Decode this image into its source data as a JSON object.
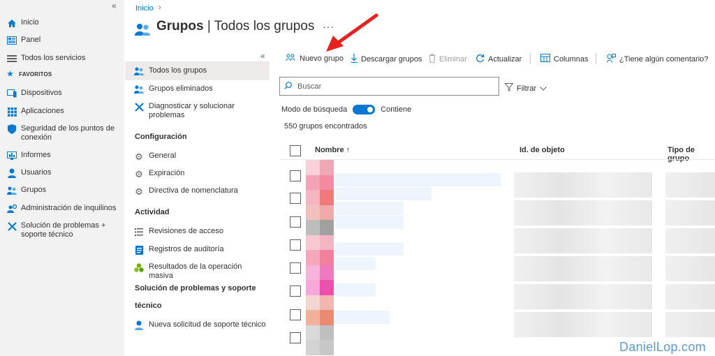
{
  "nav": {
    "items": [
      {
        "label": "Inicio",
        "icon": "home-icon"
      },
      {
        "label": "Panel",
        "icon": "dashboard-icon"
      },
      {
        "label": "Todos los servicios",
        "icon": "list-icon"
      },
      {
        "label": "Dispositivos",
        "icon": "device-icon"
      },
      {
        "label": "Aplicaciones",
        "icon": "grid-icon"
      },
      {
        "label": "Seguridad de los puntos de conexión",
        "icon": "shield-icon"
      },
      {
        "label": "Informes",
        "icon": "report-icon"
      },
      {
        "label": "Usuarios",
        "icon": "user-icon"
      },
      {
        "label": "Grupos",
        "icon": "group-icon"
      },
      {
        "label": "Administración de inquilinos",
        "icon": "tenant-icon"
      },
      {
        "label": "Solución de problemas + soporte técnico",
        "icon": "tools-icon"
      }
    ],
    "favorites_label": "FAVORITOS"
  },
  "header": {
    "breadcrumb": "Inicio",
    "title_bold": "Grupos",
    "title_rest": " | Todos los grupos",
    "more": "···"
  },
  "menu": {
    "items": [
      {
        "label": "Todos los grupos"
      },
      {
        "label": "Grupos eliminados"
      },
      {
        "label": "Diagnosticar y solucionar problemas"
      }
    ],
    "config_title": "Configuración",
    "config_items": [
      {
        "label": "General"
      },
      {
        "label": "Expiración"
      },
      {
        "label": "Directiva de nomenclatura"
      }
    ],
    "activity_title": "Actividad",
    "activity_items": [
      {
        "label": "Revisiones de acceso"
      },
      {
        "label": "Registros de auditoría"
      },
      {
        "label": "Resultados de la operación masiva"
      }
    ],
    "support_title_1": "Solución de problemas y soporte",
    "support_title_2": "técnico",
    "support_items": [
      {
        "label": "Nueva solicitud de soporte técnico"
      }
    ]
  },
  "toolbar": {
    "new_group": "Nuevo grupo",
    "download": "Descargar grupos",
    "delete": "Eliminar",
    "refresh": "Actualizar",
    "columns": "Columnas",
    "feedback": "¿Tiene algún comentario?"
  },
  "search": {
    "placeholder": "Buscar"
  },
  "filter": {
    "label": "Filtrar"
  },
  "mode": {
    "label": "Modo de búsqueda",
    "value": "Contiene"
  },
  "results": {
    "count": "550 grupos encontrados"
  },
  "table": {
    "columns": [
      "Nombre ↑",
      "Id. de objeto",
      "Tipo de grupo"
    ]
  },
  "colors": {
    "accent": "#0078d4",
    "arrow": "#e8211c"
  },
  "watermark": "DanielLop.com"
}
